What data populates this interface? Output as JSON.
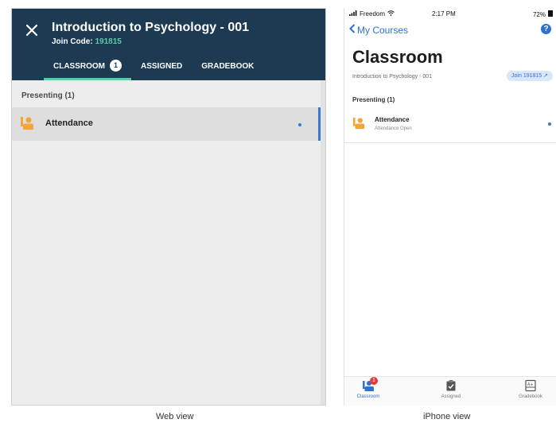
{
  "web": {
    "course_title": "Introduction to Psychology - 001",
    "join_label": "Join Code:",
    "join_code": "191815",
    "tabs": [
      {
        "label": "CLASSROOM",
        "badge": "1",
        "active": true
      },
      {
        "label": "ASSIGNED"
      },
      {
        "label": "GRADEBOOK"
      }
    ],
    "section_label": "Presenting (1)",
    "item_label": "Attendance",
    "icon_names": [
      "close-icon",
      "presenter-icon"
    ]
  },
  "phone": {
    "status": {
      "carrier": "Freedom",
      "time": "2:17 PM",
      "battery": "72%"
    },
    "back_label": "My Courses",
    "help_label": "?",
    "title": "Classroom",
    "course_name": "Introduction to Psychology - 001",
    "join_pill": "Join 191815 ↗",
    "section_label": "Presenting (1)",
    "item_label": "Attendance",
    "item_sub": "Attendance Open",
    "tabs": [
      {
        "label": "Classroom",
        "badge": "1",
        "active": true
      },
      {
        "label": "Assigned"
      },
      {
        "label": "Gradebook"
      }
    ]
  },
  "captions": {
    "web": "Web view",
    "phone": "iPhone view"
  },
  "colors": {
    "header": "#1d3a53",
    "accent": "#5cc9a7",
    "ios_blue": "#2f6fd6",
    "presenter": "#f2a53a"
  }
}
